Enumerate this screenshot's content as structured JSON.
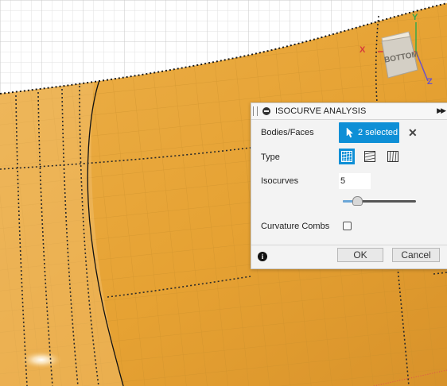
{
  "viewcube": {
    "face_label": "BOTTOM",
    "axis_x": "X",
    "axis_y": "Y",
    "axis_z": "Z"
  },
  "dialog": {
    "title": "ISOCURVE ANALYSIS",
    "bodies_label": "Bodies/Faces",
    "selection_text": "2 selected",
    "type_label": "Type",
    "type_options": [
      "both-directions",
      "u-direction",
      "v-direction"
    ],
    "type_selected": "both-directions",
    "isocurves_label": "Isocurves",
    "isocurves_value": "5",
    "isocurves_slider_fraction": 0.2,
    "curvature_combs_label": "Curvature Combs",
    "curvature_combs_checked": false,
    "ok_label": "OK",
    "cancel_label": "Cancel"
  },
  "colors": {
    "surface": "#e8a838",
    "selection_blue": "#0e8fd6",
    "grid": "#d9d9d9"
  }
}
